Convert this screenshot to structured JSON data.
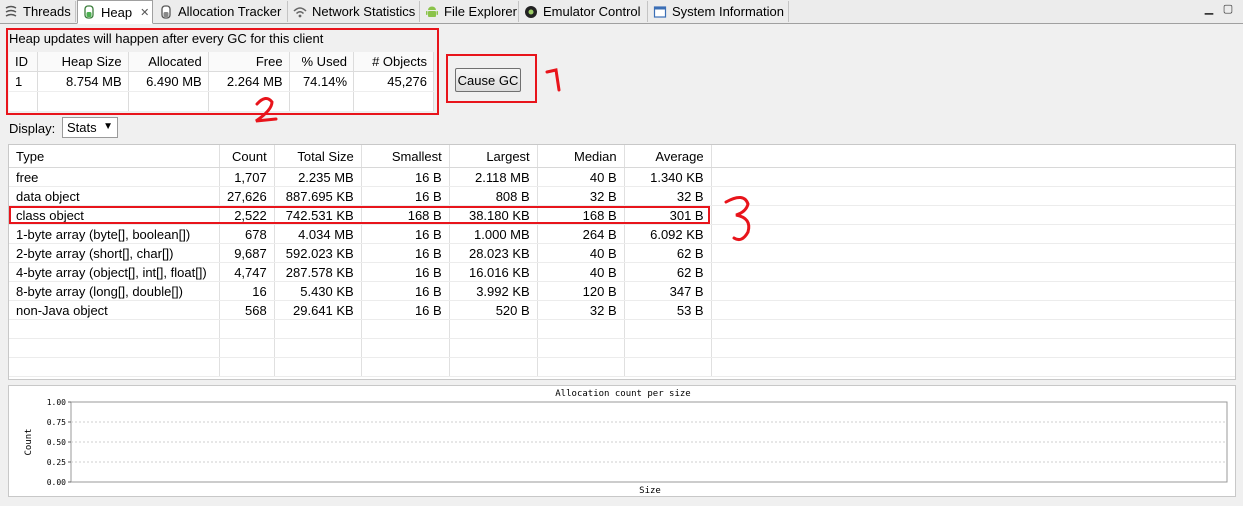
{
  "tabs": [
    {
      "label": "Threads",
      "icon": "threads-icon",
      "active": false
    },
    {
      "label": "Heap",
      "icon": "heap-icon",
      "active": true
    },
    {
      "label": "Allocation Tracker",
      "icon": "allocation-tracker-icon",
      "active": false
    },
    {
      "label": "Network Statistics",
      "icon": "network-icon",
      "active": false
    },
    {
      "label": "File Explorer",
      "icon": "android-icon",
      "active": false
    },
    {
      "label": "Emulator Control",
      "icon": "emulator-icon",
      "active": false
    },
    {
      "label": "System Information",
      "icon": "system-info-icon",
      "active": false
    }
  ],
  "heap": {
    "notice": "Heap updates will happen after every GC for this client",
    "headers": [
      "ID",
      "Heap Size",
      "Allocated",
      "Free",
      "% Used",
      "# Objects"
    ],
    "row": [
      "1",
      "8.754 MB",
      "6.490 MB",
      "2.264 MB",
      "74.14%",
      "45,276"
    ],
    "cause_gc_label": "Cause GC"
  },
  "display": {
    "label": "Display:",
    "selected": "Stats"
  },
  "stats": {
    "headers": [
      "Type",
      "Count",
      "Total Size",
      "Smallest",
      "Largest",
      "Median",
      "Average"
    ],
    "rows": [
      [
        "free",
        "1,707",
        "2.235 MB",
        "16 B",
        "2.118 MB",
        "40 B",
        "1.340 KB"
      ],
      [
        "data object",
        "27,626",
        "887.695 KB",
        "16 B",
        "808 B",
        "32 B",
        "32 B"
      ],
      [
        "class object",
        "2,522",
        "742.531 KB",
        "168 B",
        "38.180 KB",
        "168 B",
        "301 B"
      ],
      [
        "1-byte array (byte[], boolean[])",
        "678",
        "4.034 MB",
        "16 B",
        "1.000 MB",
        "264 B",
        "6.092 KB"
      ],
      [
        "2-byte array (short[], char[])",
        "9,687",
        "592.023 KB",
        "16 B",
        "28.023 KB",
        "40 B",
        "62 B"
      ],
      [
        "4-byte array (object[], int[], float[])",
        "4,747",
        "287.578 KB",
        "16 B",
        "16.016 KB",
        "40 B",
        "62 B"
      ],
      [
        "8-byte array (long[], double[])",
        "16",
        "5.430 KB",
        "16 B",
        "3.992 KB",
        "120 B",
        "347 B"
      ],
      [
        "non-Java object",
        "568",
        "29.641 KB",
        "16 B",
        "520 B",
        "32 B",
        "53 B"
      ]
    ]
  },
  "chart_data": {
    "type": "bar",
    "title": "Allocation count per size",
    "xlabel": "Size",
    "ylabel": "Count",
    "y_ticks": [
      "1.00",
      "0.75",
      "0.50",
      "0.25",
      "0.00"
    ],
    "ylim": [
      0,
      1
    ],
    "series": [],
    "grid": true
  },
  "annotations": {
    "color": "#e8141b",
    "marks": [
      "1",
      "2",
      "3"
    ]
  }
}
